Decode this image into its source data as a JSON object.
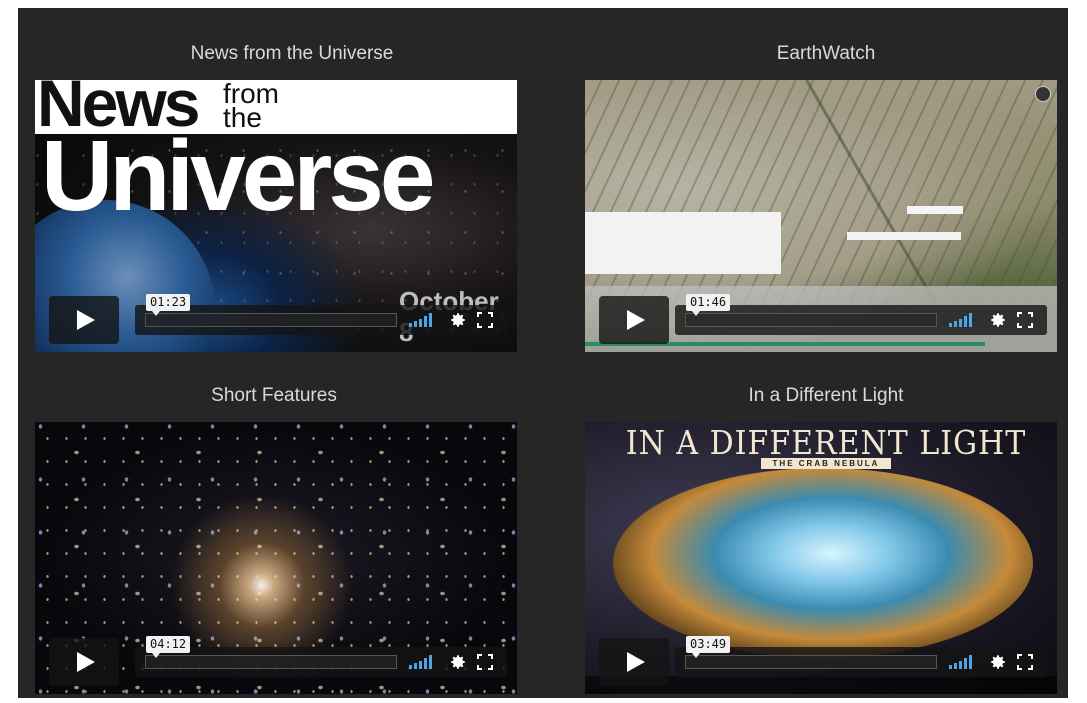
{
  "cards": [
    {
      "title": "News from the Universe",
      "time": "01:23",
      "thumb": {
        "word1": "News",
        "word2": "from",
        "word3": "the",
        "word4": "Universe",
        "date": "October 8"
      }
    },
    {
      "title": "EarthWatch",
      "time": "01:46"
    },
    {
      "title": "Short Features",
      "time": "04:12"
    },
    {
      "title": "In a Different Light",
      "time": "03:49",
      "thumb": {
        "headline": "IN A DIFFERENT LIGHT",
        "subhead": "THE CRAB NEBULA"
      }
    }
  ],
  "controls": {
    "play_icon": "play-icon",
    "volume_icon": "volume-bars-icon",
    "settings_icon": "gear-icon",
    "fullscreen_icon": "fullscreen-icon",
    "accent_color": "#4da4e6"
  }
}
